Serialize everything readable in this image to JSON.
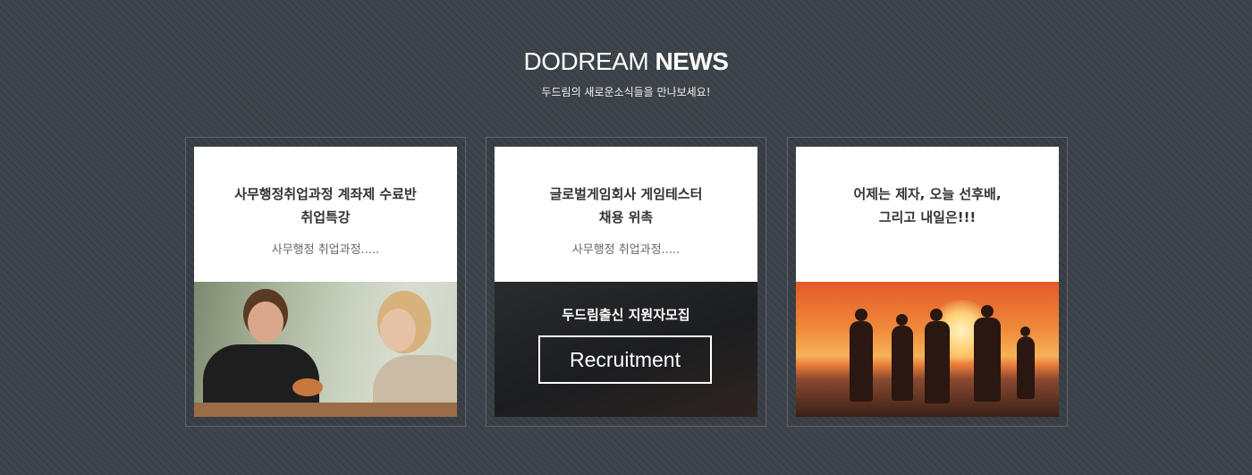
{
  "section": {
    "title_light": "DODREAM",
    "title_bold": "NEWS",
    "subtitle": "두드림의 새로운소식들을 만나보세요!"
  },
  "cards": [
    {
      "title_line1": "사무행정취업과정 계좌제 수료반",
      "title_line2": "취업특강",
      "excerpt": "사무행정 취업과정....."
    },
    {
      "title_line1": "글로벌게임회사  게임테스터",
      "title_line2": "채용 위촉",
      "excerpt": "사무행정 취업과정.....",
      "overlay_caption": "두드림출신 지원자모집",
      "button_label": "Recruitment"
    },
    {
      "title_line1": "어제는 제자, 오늘 선후배,",
      "title_line2": "그리고 내일은!!!",
      "excerpt": ""
    }
  ]
}
